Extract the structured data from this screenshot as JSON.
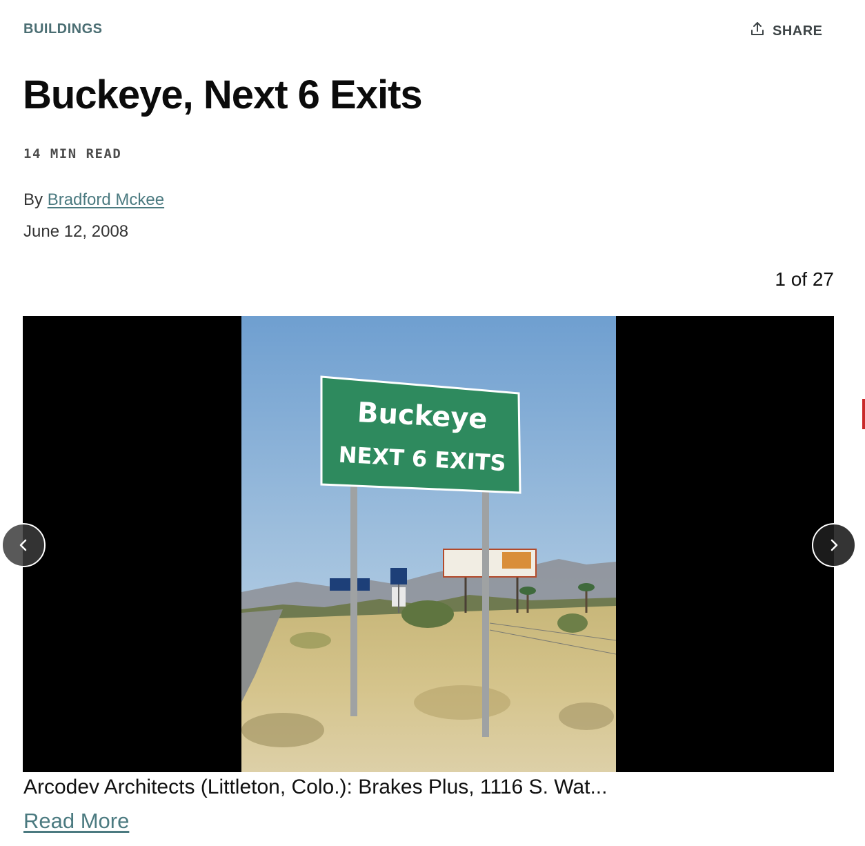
{
  "article": {
    "category": "BUILDINGS",
    "title": "Buckeye, Next 6 Exits",
    "read_time": "14 MIN READ",
    "by_prefix": "By",
    "author": "Bradford Mckee",
    "date": "June 12, 2008"
  },
  "share": {
    "label": "SHARE",
    "icon": "share-upload-icon"
  },
  "slideshow": {
    "counter": "1 of 27",
    "prev_icon": "chevron-left-icon",
    "next_icon": "chevron-right-icon",
    "sign": {
      "line1": "Buckeye",
      "line2": "NEXT 6 EXITS"
    },
    "caption": "Arcodev Architects (Littleton, Colo.): Brakes Plus, 1116 S. Wat...",
    "read_more": "Read More"
  },
  "colors": {
    "accent": "#4b7a80",
    "sign_green": "#2e8a5e",
    "background": "#ffffff"
  }
}
